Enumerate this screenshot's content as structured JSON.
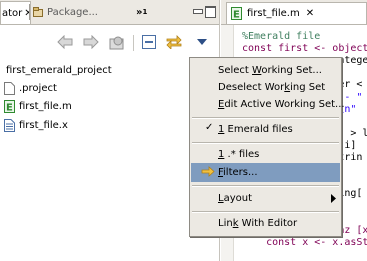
{
  "left": {
    "tabs": [
      {
        "label": "ator",
        "active": true
      },
      {
        "label": "Package...",
        "active": false
      }
    ],
    "overflow": {
      "arrows": "»",
      "count": "1"
    },
    "tree": [
      {
        "label": "first_emerald_project"
      },
      {
        "label": ".project"
      },
      {
        "label": "first_file.m"
      },
      {
        "label": "first_file.x"
      }
    ]
  },
  "editor": {
    "tab_label": "first_file.m",
    "lines": [
      {
        "text": "%Emerald file",
        "color": "#3f7f5f"
      },
      {
        "text": "const first <- object",
        "color": "#7f0055"
      },
      {
        "text": "                ntege",
        "color": "#000000"
      },
      {
        "text": "",
        "color": "#000000"
      },
      {
        "text": "                er <",
        "color": "#000000"
      },
      {
        "text": "                 - \"",
        "color": "#2a00ff"
      },
      {
        "text": "                \\n\"",
        "color": "#2a00ff"
      },
      {
        "text": "",
        "color": "#000000"
      },
      {
        "text": "                  > l",
        "color": "#000000"
      },
      {
        "text": "                [i]",
        "color": "#000000"
      },
      {
        "text": "                trin",
        "color": "#000000"
      },
      {
        "text": "",
        "color": "#000000"
      },
      {
        "text": "",
        "color": "#000000"
      },
      {
        "text": "                ing[",
        "color": "#000000"
      },
      {
        "text": "",
        "color": "#000000"
      },
      {
        "text": "  end initially",
        "color": "#7f0055"
      },
      {
        "text": "  operation foobaz [x",
        "color": "#7f0055"
      },
      {
        "text": "    const x <- x.asSt",
        "color": "#7f0055"
      }
    ]
  },
  "menu": {
    "items": [
      {
        "label": "Select Working Set...",
        "mnemonic": "W",
        "checked": false,
        "selected": false,
        "submenu": false
      },
      {
        "label": "Deselect Working Set",
        "mnemonic": "k",
        "checked": false,
        "selected": false,
        "submenu": false
      },
      {
        "label": "Edit Active Working Set...",
        "mnemonic": "E",
        "checked": false,
        "selected": false,
        "submenu": false
      },
      {
        "label": "1 Emerald files",
        "mnemonic": "1",
        "checked": true,
        "selected": false,
        "submenu": false
      },
      {
        "label": "1 .* files",
        "mnemonic": "1",
        "checked": false,
        "selected": false,
        "submenu": false
      },
      {
        "label": "Filters...",
        "mnemonic": "F",
        "checked": false,
        "selected": true,
        "submenu": false
      },
      {
        "label": "Layout",
        "mnemonic": "L",
        "checked": false,
        "selected": false,
        "submenu": true
      },
      {
        "label": "Link With Editor",
        "mnemonic": "k",
        "checked": false,
        "selected": false,
        "submenu": false
      }
    ]
  },
  "colors": {
    "selection": "#7f9cbf",
    "menu_bg": "#ece9e3",
    "tab_bg": "#ece9e3",
    "emerald_icon": "#2f8a2f"
  }
}
